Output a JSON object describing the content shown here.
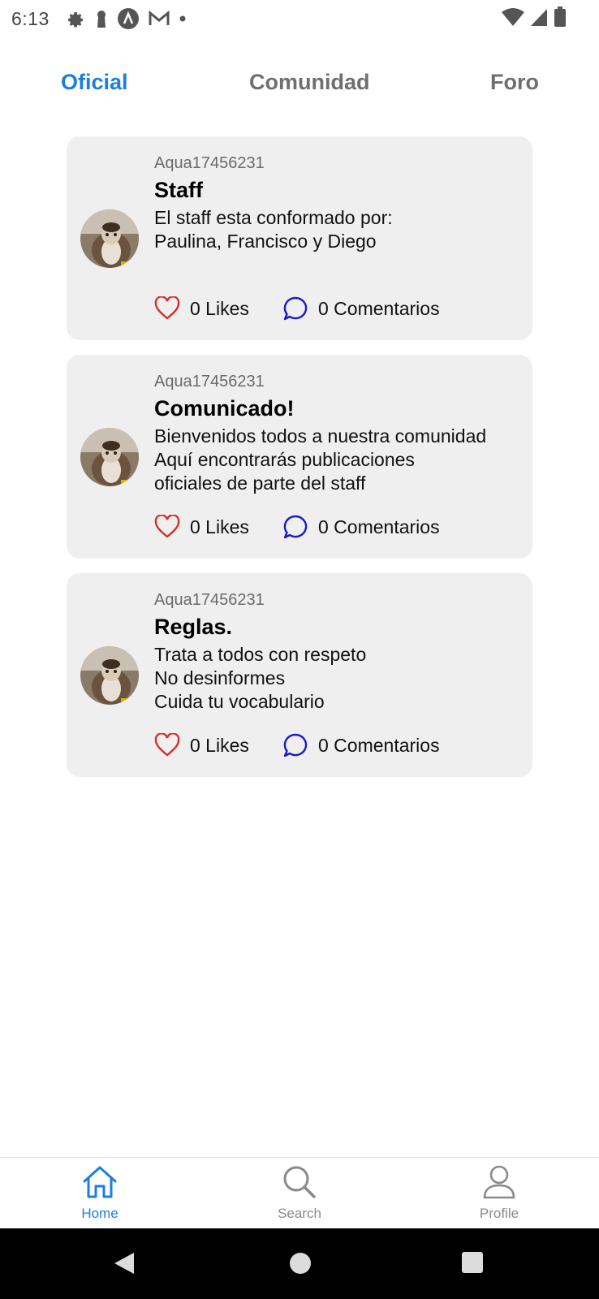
{
  "status_bar": {
    "time": "6:13",
    "left_icons": [
      "settings-icon",
      "keyhole-icon",
      "app-a-icon",
      "gmail-icon",
      "dot-icon"
    ],
    "right_icons": [
      "wifi-icon",
      "signal-icon",
      "battery-icon"
    ]
  },
  "tabs": [
    {
      "label": "Oficial",
      "active": true
    },
    {
      "label": "Comunidad",
      "active": false
    },
    {
      "label": "Foro",
      "active": false
    }
  ],
  "posts": [
    {
      "author": "Aqua17456231",
      "title": "Staff",
      "text": "El staff esta conformado por:\nPaulina, Francisco y Diego",
      "likes": "0 Likes",
      "comments": "0 Comentarios"
    },
    {
      "author": "Aqua17456231",
      "title": "Comunicado!",
      "text": "Bienvenidos todos a nuestra comunidad\nAquí encontrarás publicaciones\noficiales de parte del staff",
      "likes": "0 Likes",
      "comments": "0 Comentarios"
    },
    {
      "author": "Aqua17456231",
      "title": "Reglas.",
      "text": "Trata a todos con respeto\nNo desinformes\nCuida tu vocabulario",
      "likes": "0 Likes",
      "comments": "0 Comentarios"
    }
  ],
  "bottom_nav": [
    {
      "label": "Home",
      "icon": "home-icon",
      "active": true
    },
    {
      "label": "Search",
      "icon": "search-icon",
      "active": false
    },
    {
      "label": "Profile",
      "icon": "profile-icon",
      "active": false
    }
  ],
  "colors": {
    "accent": "#1a7fe0",
    "like_icon": "#d32f2f",
    "comment_icon": "#1a1ac8",
    "card_background": "#efefef"
  }
}
